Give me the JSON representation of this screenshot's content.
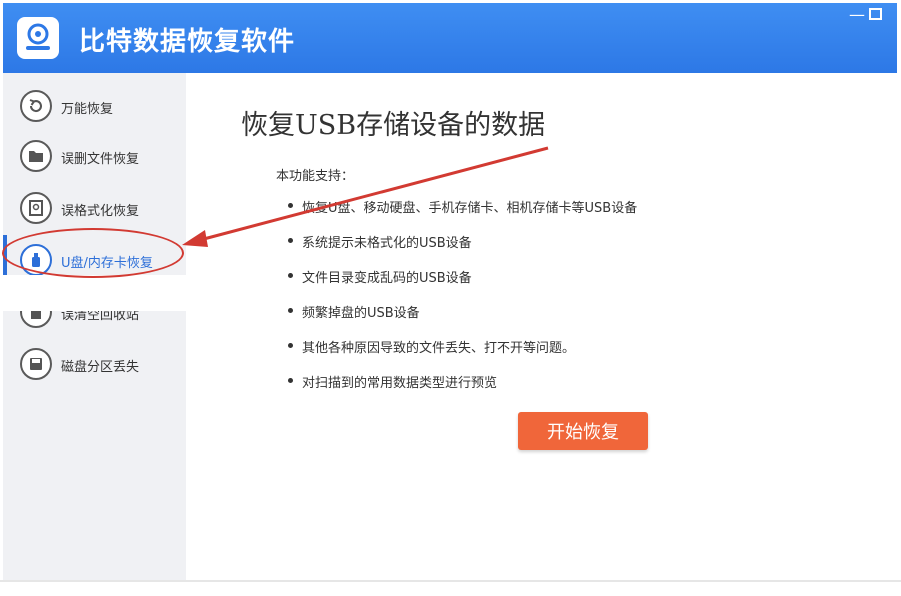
{
  "app": {
    "title": "比特数据恢复软件",
    "window_controls": [
      "minimize",
      "maximize"
    ]
  },
  "sidebar": {
    "items": [
      {
        "label": "万能恢复",
        "icon": "undo-icon"
      },
      {
        "label": "误删文件恢复",
        "icon": "folder-icon"
      },
      {
        "label": "误格式化恢复",
        "icon": "disk-icon"
      },
      {
        "label": "U盘/内存卡恢复",
        "icon": "usb-icon",
        "active": true
      },
      {
        "label": "误清空回收站",
        "icon": "trash-icon"
      },
      {
        "label": "磁盘分区丢失",
        "icon": "partition-icon"
      }
    ]
  },
  "main": {
    "title": "恢复USB存储设备的数据",
    "subtitle": "本功能支持：",
    "features": [
      "恢复U盘、移动硬盘、手机存储卡、相机存储卡等USB设备",
      "系统提示未格式化的USB设备",
      "文件目录变成乱码的USB设备",
      "频繁掉盘的USB设备",
      "其他各种原因导致的文件丢失、打不开等问题。",
      "对扫描到的常用数据类型进行预览"
    ],
    "start_button": "开始恢复"
  },
  "colors": {
    "titlebar": "#2d78e6",
    "accent": "#2d6fd8",
    "button": "#f0663a",
    "annotation": "#d23a32",
    "sidebar_bg": "#f0f1f4"
  }
}
